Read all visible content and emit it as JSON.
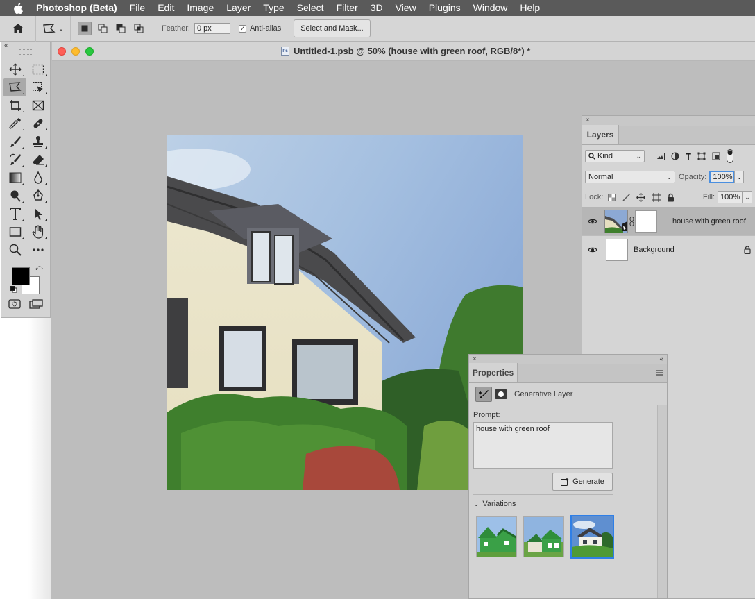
{
  "menu": {
    "app": "Photoshop (Beta)",
    "items": [
      "File",
      "Edit",
      "Image",
      "Layer",
      "Type",
      "Select",
      "Filter",
      "3D",
      "View",
      "Plugins",
      "Window",
      "Help"
    ]
  },
  "options": {
    "feather_label": "Feather:",
    "feather_value": "0 px",
    "antialias_label": "Anti-alias",
    "antialias_checked": true,
    "select_mask_label": "Select and Mask..."
  },
  "toolbar": {
    "collapse": "«",
    "swap_glyph": "⤺"
  },
  "document": {
    "psb_icon_text": "Ps",
    "title": "Untitled-1.psb @ 50% (house with green roof, RGB/8*) *"
  },
  "layers_panel": {
    "close": "×",
    "tab": "Layers",
    "kind_label": "Kind",
    "blend_mode": "Normal",
    "opacity_label": "Opacity:",
    "opacity_value": "100%",
    "lock_label": "Lock:",
    "fill_label": "Fill:",
    "fill_value": "100%",
    "layers": [
      {
        "name": "house with green roof",
        "visible": true,
        "selected": true
      },
      {
        "name": "Background",
        "visible": true,
        "locked": true
      }
    ]
  },
  "properties_panel": {
    "close": "×",
    "collapse": "«",
    "tab": "Properties",
    "layer_type": "Generative Layer",
    "prompt_label": "Prompt:",
    "prompt_value": "house with green roof",
    "generate_label": "Generate",
    "variations_label": "Variations",
    "selected_variation": 3
  },
  "colors": {
    "menubar": "#5a5a5a",
    "panel": "#d5d5d5",
    "canvas": "#bdbdbd",
    "accent": "#2f7fe6",
    "foreground": "#000000",
    "background": "#ffffff"
  }
}
